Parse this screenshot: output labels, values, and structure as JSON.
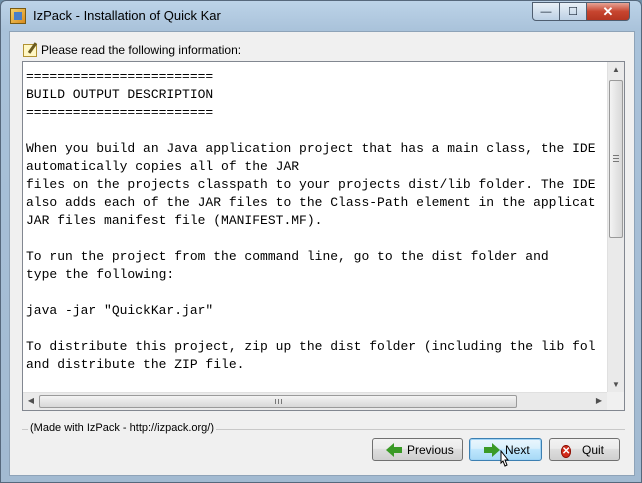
{
  "window": {
    "title": "IzPack - Installation of Quick Kar",
    "controls": {
      "minimize_glyph": "—",
      "maximize_glyph": "☐",
      "close_glyph": "✕"
    }
  },
  "panel": {
    "info_label": "Please read the following information:",
    "text_content": "========================\nBUILD OUTPUT DESCRIPTION\n========================\n\nWhen you build an Java application project that has a main class, the IDE\nautomatically copies all of the JAR\nfiles on the projects classpath to your projects dist/lib folder. The IDE\nalso adds each of the JAR files to the Class-Path element in the applicat\nJAR files manifest file (MANIFEST.MF).\n\nTo run the project from the command line, go to the dist folder and\ntype the following:\n\njava -jar \"QuickKar.jar\"\n\nTo distribute this project, zip up the dist folder (including the lib fol\nand distribute the ZIP file.\n\nNotes:"
  },
  "footer": {
    "made_with": "(Made with IzPack - http://izpack.org/)",
    "buttons": {
      "previous": "Previous",
      "next": "Next",
      "quit": "Quit"
    }
  },
  "icons": {
    "app": "izpack-app-icon",
    "info": "note-pencil-icon",
    "previous": "green-left-arrow-icon",
    "next": "green-right-arrow-icon",
    "quit": "red-stop-icon"
  },
  "colors": {
    "title_bar": "#bcd3e8",
    "close_button": "#c7452f",
    "arrow_green": "#3a9a26",
    "next_button_focus": "#bee6fd"
  }
}
